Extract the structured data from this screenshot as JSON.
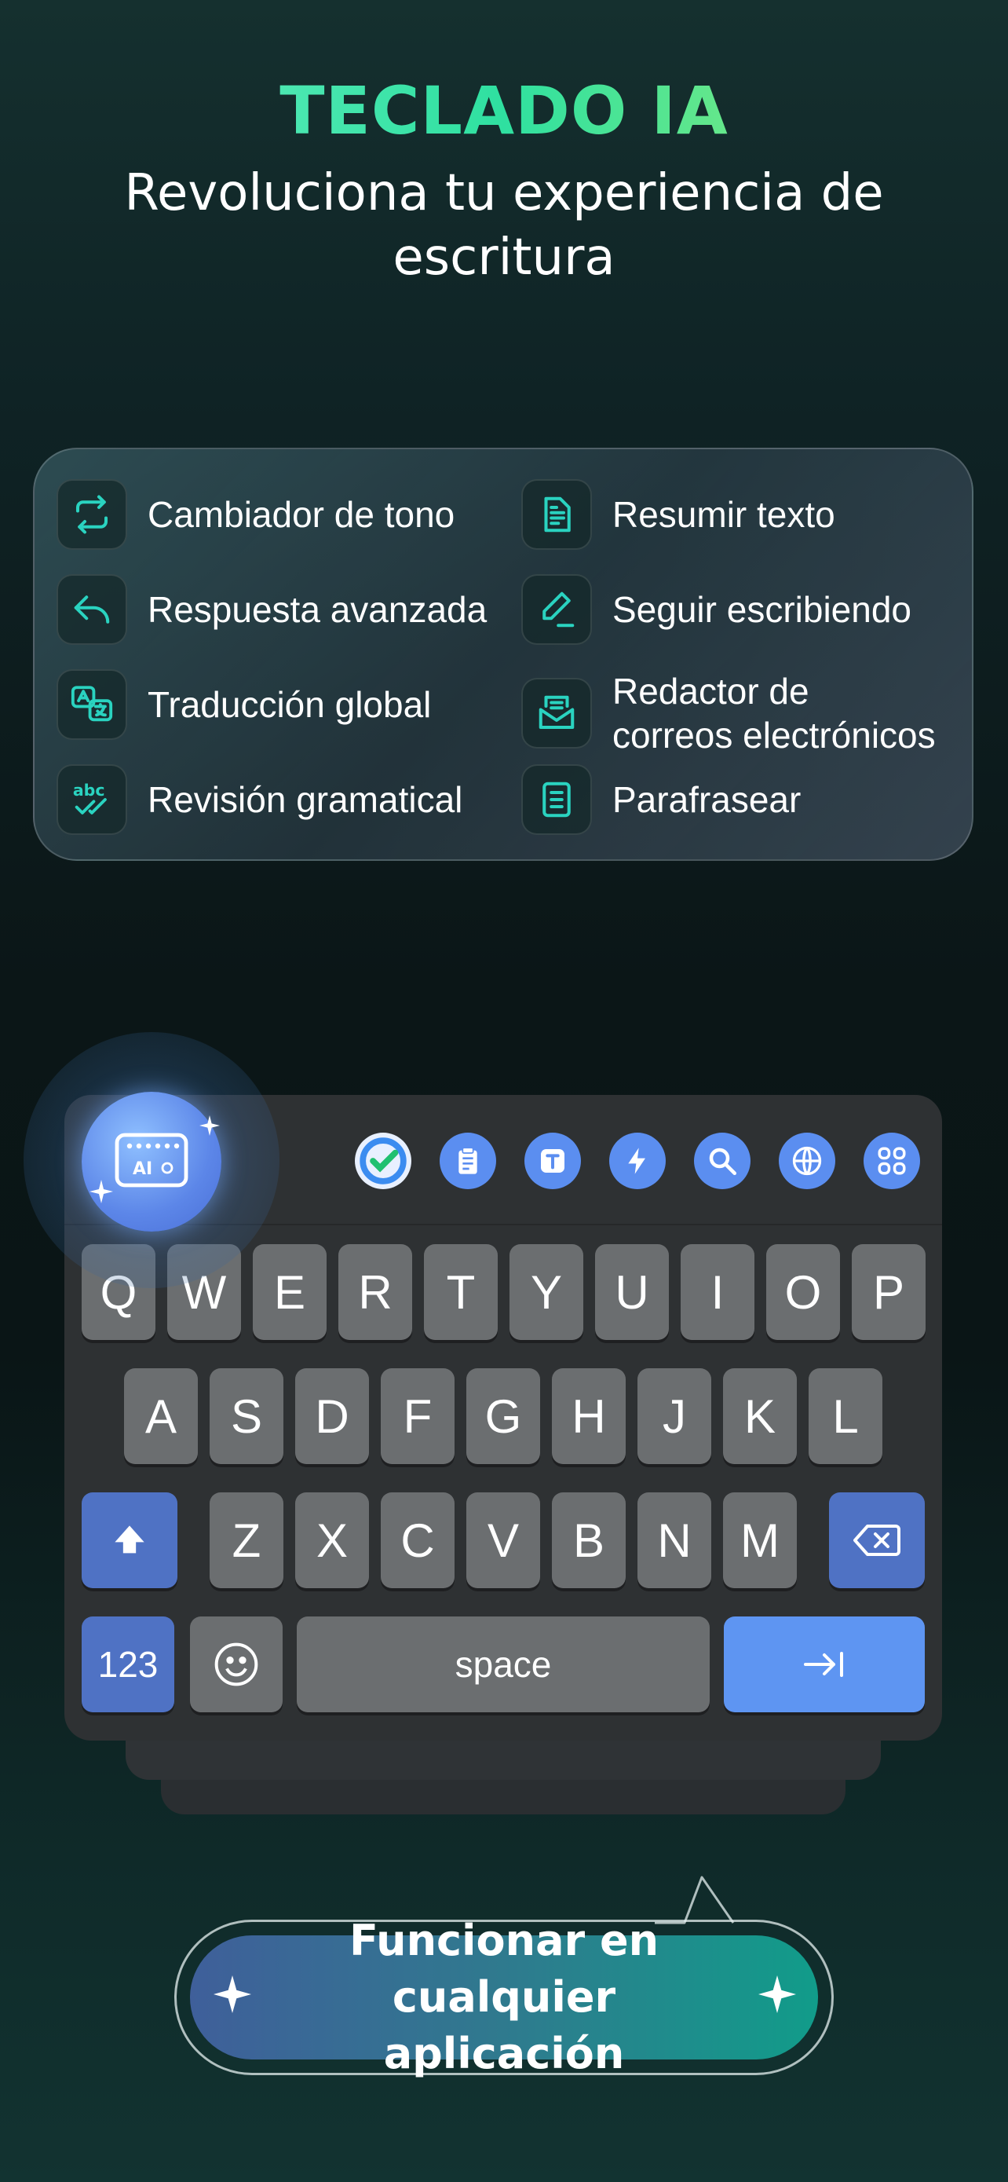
{
  "header": {
    "title": "TECLADO IA",
    "subtitle": "Revoluciona tu experiencia de escritura"
  },
  "features": [
    {
      "label": "Cambiador de tono",
      "icon": "refresh-icon"
    },
    {
      "label": "Resumir texto",
      "icon": "document-icon"
    },
    {
      "label": "Respuesta avanzada",
      "icon": "reply-icon"
    },
    {
      "label": "Seguir escribiendo",
      "icon": "pen-icon"
    },
    {
      "label": "Traducción global",
      "icon": "translate-icon"
    },
    {
      "label": "Redactor de\ncorreos electrónicos",
      "icon": "mail-icon"
    },
    {
      "label": "Revisión gramatical",
      "icon": "abc-check-icon"
    },
    {
      "label": "Parafrasear",
      "icon": "paraphrase-icon"
    }
  ],
  "ai_button": {
    "label": "AI"
  },
  "toolbar": {
    "icons": [
      "grammar-check-icon",
      "clipboard-icon",
      "text-icon",
      "bolt-icon",
      "search-icon",
      "globe-icon",
      "apps-grid-icon"
    ]
  },
  "keyboard": {
    "row1": [
      "Q",
      "W",
      "E",
      "R",
      "T",
      "Y",
      "U",
      "I",
      "O",
      "P"
    ],
    "row2": [
      "A",
      "S",
      "D",
      "F",
      "G",
      "H",
      "J",
      "K",
      "L"
    ],
    "row3": [
      "Z",
      "X",
      "C",
      "V",
      "B",
      "N",
      "M"
    ],
    "numbers_key": "123",
    "space_key": "space",
    "enter_glyph": "→|"
  },
  "cta": {
    "label": "Funcionar en cualquier aplicación"
  },
  "colors": {
    "accent": "#2fe0a0",
    "key": "#6b6e70",
    "key_blue": "#4f72c4",
    "key_bright": "#5e95f2",
    "icon_teal": "#2ad3c0"
  }
}
